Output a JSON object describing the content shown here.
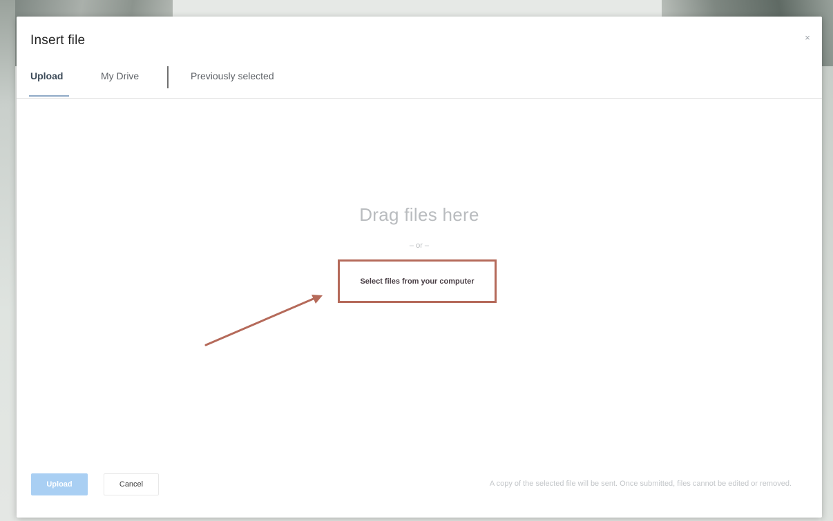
{
  "dialog": {
    "title": "Insert file",
    "close_label": "×"
  },
  "tabs": [
    {
      "label": "Upload",
      "active": true
    },
    {
      "label": "My Drive",
      "active": false
    },
    {
      "label": "Previously selected",
      "active": false
    }
  ],
  "drop_zone": {
    "drag_text": "Drag files here",
    "or_text": "– or –",
    "select_button_label": "Select files from your computer"
  },
  "footer": {
    "upload_label": "Upload",
    "cancel_label": "Cancel",
    "note": "A copy of the selected file will be sent. Once submitted, files cannot be edited or removed."
  },
  "colors": {
    "highlight_box": "#b56a5a",
    "arrow": "#b56a5a",
    "upload_button": "#a9cff3",
    "tab_underline": "#8ea9c6"
  }
}
